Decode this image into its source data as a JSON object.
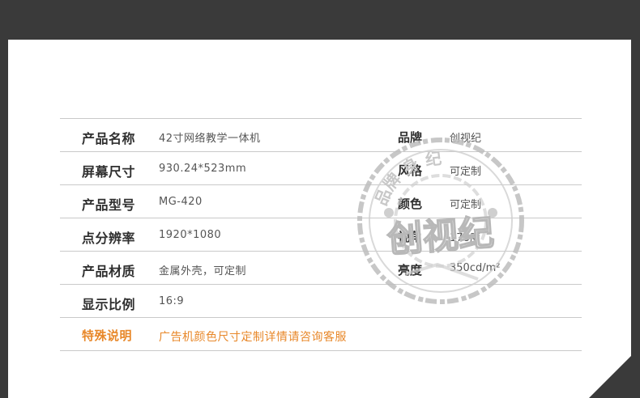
{
  "spec_rows": [
    {
      "label": "产品名称",
      "value": "42寸网络教学一体机",
      "label2": "品牌",
      "value2": "创视纪"
    },
    {
      "label": "屏幕尺寸",
      "value": "930.24*523mm",
      "label2": "风格",
      "value2": "可定制"
    },
    {
      "label": "产品型号",
      "value": "MG-420",
      "label2": "颜色",
      "value2": "可定制"
    },
    {
      "label": "点分辨率",
      "value": "1920*1080",
      "label2": "视角",
      "value2": "178度"
    },
    {
      "label": "产品材质",
      "value": "金属外壳，可定制",
      "label2": "亮度",
      "value2": "350cd/m²"
    },
    {
      "label": "显示比例",
      "value": "16:9"
    }
  ],
  "special": {
    "label": "特殊说明",
    "value": "广告机颜色尺寸定制详情请咨询客服"
  },
  "watermark": {
    "text": "创视纪",
    "ring_text": "品牌 身 纪"
  },
  "colors": {
    "background": "#3a3a3a",
    "card": "#ffffff",
    "accent": "#e8882a",
    "label": "#2f2f2f",
    "divider": "#c9c9c9"
  }
}
